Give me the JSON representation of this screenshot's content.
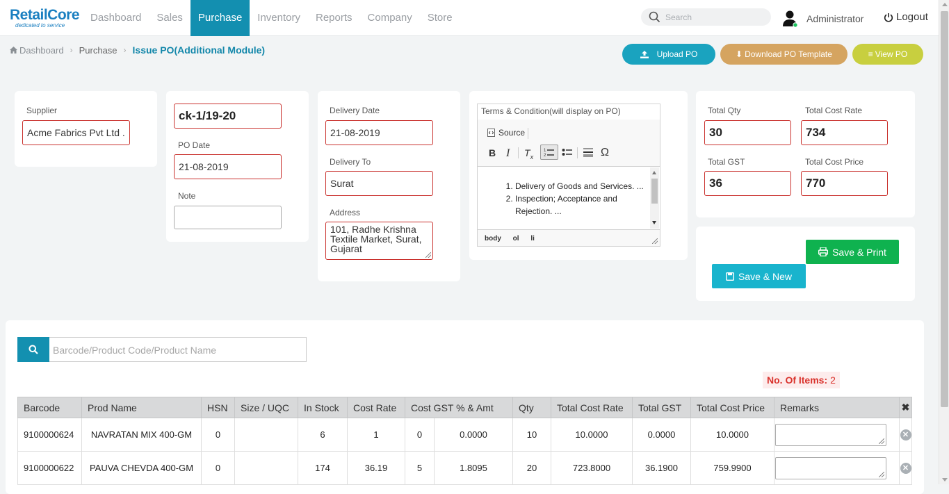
{
  "brand": {
    "name": "RetailCore",
    "tagline": "dedicated to service"
  },
  "nav": {
    "items": [
      "Dashboard",
      "Sales",
      "Purchase",
      "Inventory",
      "Reports",
      "Company",
      "Store"
    ],
    "active": "Purchase"
  },
  "search": {
    "placeholder": "Search"
  },
  "user": {
    "name": "Administrator",
    "logout": "Logout"
  },
  "breadcrumb": {
    "home": "Dashboard",
    "section": "Purchase",
    "current": "Issue PO(Additional Module)"
  },
  "actions": {
    "upload": "Upload PO",
    "download": "Download PO Template",
    "view": "View PO"
  },
  "supplier": {
    "label": "Supplier",
    "value": "Acme Fabrics Pvt Ltd ."
  },
  "po": {
    "number": "ck-1/19-20",
    "date_label": "PO Date",
    "date": "21-08-2019",
    "note_label": "Note",
    "note": ""
  },
  "delivery": {
    "date_label": "Delivery Date",
    "date": "21-08-2019",
    "to_label": "Delivery To",
    "to": "Surat",
    "address_label": "Address",
    "address": "101, Radhe Krishna Textile Market, Surat, Gujarat"
  },
  "terms": {
    "title": "Terms & Condition(will display on PO)",
    "source_label": "Source",
    "items": [
      "Delivery of Goods and Services. ...",
      "Inspection; Acceptance and Rejection. ..."
    ],
    "footer": [
      "body",
      "ol",
      "li"
    ]
  },
  "totals": {
    "qty_label": "Total Qty",
    "qty": "30",
    "rate_label": "Total Cost Rate",
    "rate": "734",
    "gst_label": "Total GST",
    "gst": "36",
    "price_label": "Total Cost Price",
    "price": "770"
  },
  "buttons": {
    "save_print": "Save & Print",
    "save_new": "Save & New"
  },
  "product_search": {
    "placeholder": "Barcode/Product Code/Product Name"
  },
  "items_count": {
    "label": "No. Of Items:",
    "value": "2"
  },
  "table": {
    "headers": [
      "Barcode",
      "Prod Name",
      "HSN",
      "Size / UQC",
      "In Stock",
      "Cost Rate",
      "Cost GST % & Amt",
      "Qty",
      "Total Cost Rate",
      "Total GST",
      "Total Cost Price",
      "Remarks",
      "✖"
    ],
    "rows": [
      {
        "barcode": "9100000624",
        "name": "NAVRATAN MIX 400-GM",
        "hsn": "0",
        "size": "",
        "stock": "6",
        "rate": "1",
        "gst_pct": "0",
        "gst_amt": "0.0000",
        "qty": "10",
        "total_rate": "10.0000",
        "total_gst": "0.0000",
        "total_price": "10.0000"
      },
      {
        "barcode": "9100000622",
        "name": "PAUVA CHEVDA 400-GM",
        "hsn": "0",
        "size": "",
        "stock": "174",
        "rate": "36.19",
        "gst_pct": "5",
        "gst_amt": "1.8095",
        "qty": "20",
        "total_rate": "723.8000",
        "total_gst": "36.1900",
        "total_price": "759.9900"
      }
    ]
  },
  "colors": {
    "primary": "#138fb0",
    "upload": "#1aa3bf",
    "download": "#d5a460",
    "view": "#c8cf3f",
    "save_print": "#0fb24f",
    "save_new": "#19b4cd",
    "error_border": "#c9302c"
  }
}
